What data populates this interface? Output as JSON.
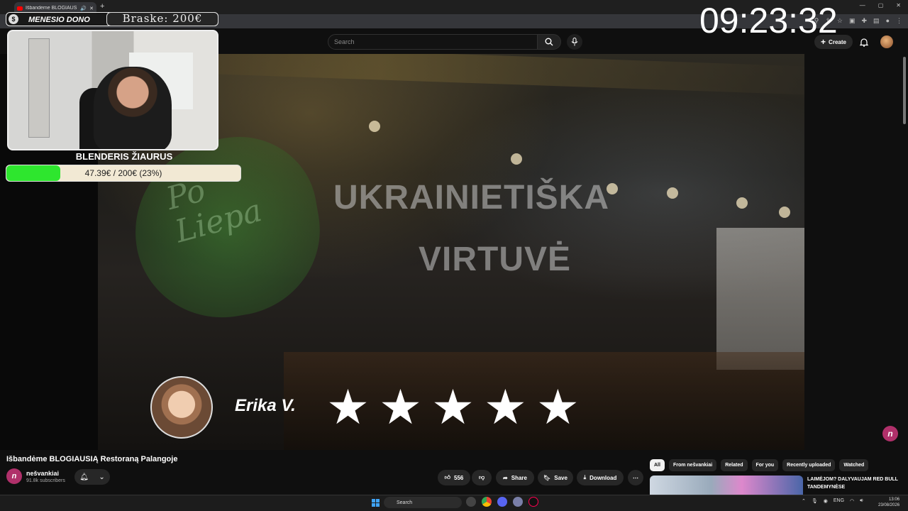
{
  "browser": {
    "tab_title": "Išbandėme BLOGIAUSIĄ Re...",
    "new_tab": "+",
    "window_controls": [
      "—",
      "▢",
      "✕"
    ]
  },
  "youtube": {
    "search_placeholder": "Search",
    "create_label": "Create"
  },
  "overlay": {
    "banner_label": "MENESIO DONO",
    "banner_value": "Braske: 200€",
    "clock": "09:23:32",
    "goal_title": "BLENDERIS ŽIAURUS",
    "goal_text": "47.39€ / 200€ (23%)",
    "goal_progress": 0.23
  },
  "video_scene": {
    "leaf_text_1": "Po",
    "leaf_text_2": "Liepa",
    "window_text_1": "UKRAINIETIŠKA",
    "window_text_2": "VIRTUVĖ",
    "reviewer_name": "Erika V.",
    "stars": 5
  },
  "video": {
    "title": "Išbandėme BLOGIAUSIĄ Restoraną Palangoje",
    "channel_name": "nešvankiai",
    "subscribers": "91.8k subscribers",
    "likes": "556",
    "share_label": "Share",
    "save_label": "Save",
    "download_label": "Download"
  },
  "chips": [
    "All",
    "From nešvankiai",
    "Related",
    "For you",
    "Recently uploaded",
    "Watched"
  ],
  "recommendation": {
    "title": "LAIMĖJOM? DALYVAUJAM RED BULL TANDEMYNĖSE"
  },
  "taskbar": {
    "search_label": "Search",
    "language": "ENG",
    "time": "13:06",
    "date": "23/08/2026"
  },
  "colors": {
    "goal_fill": "#2ee62e",
    "channel_brand": "#b0306a",
    "youtube_red": "#ff0000"
  }
}
